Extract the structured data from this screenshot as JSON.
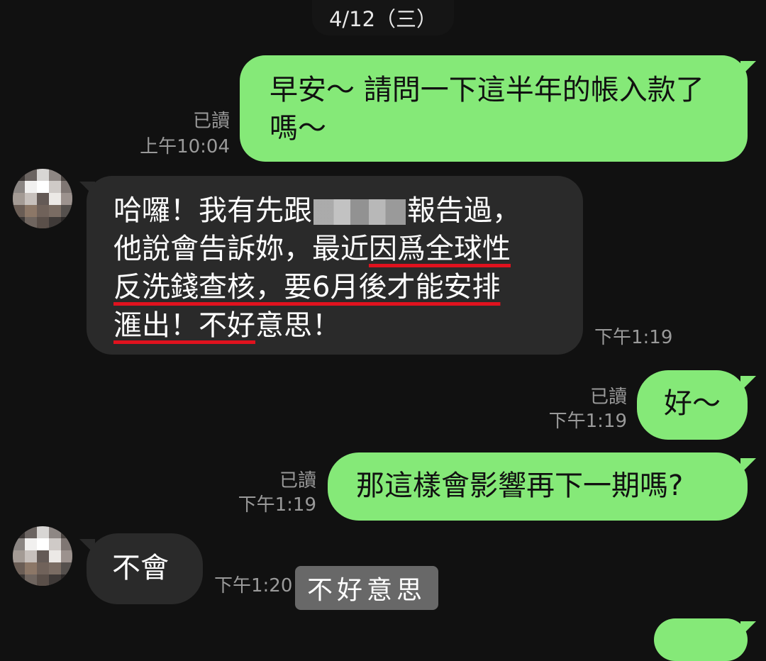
{
  "date_header": "4/12（三）",
  "messages": [
    {
      "direction": "sent",
      "text": "早安～ 請問一下這半年的帳入款了嗎～",
      "read_label": "已讀",
      "time": "上午10:04"
    },
    {
      "direction": "received",
      "text_parts": {
        "p1": "哈囉！我有先跟",
        "p2": "報告過，",
        "p3": "他說會告訴妳，最近",
        "p4": "因爲全球性",
        "p5": "反洗錢查核，要6月後才能安排",
        "p6": "滙出！不好",
        "p7": "意思！"
      },
      "time": "下午1:19"
    },
    {
      "direction": "sent",
      "text": "好～",
      "read_label": "已讀",
      "time": "下午1:19"
    },
    {
      "direction": "sent",
      "text": "那這樣會影響再下一期嗎?",
      "read_label": "已讀",
      "time": "下午1:19"
    },
    {
      "direction": "received",
      "text": "不會",
      "time": "下午1:20"
    }
  ],
  "caption_overlay": "不好意思",
  "colors": {
    "background": "#111111",
    "sent_bubble": "#85e978",
    "received_bubble": "#2a2a2a",
    "meta_text": "#9a9a9a",
    "underline_annotation": "#e0121e"
  }
}
